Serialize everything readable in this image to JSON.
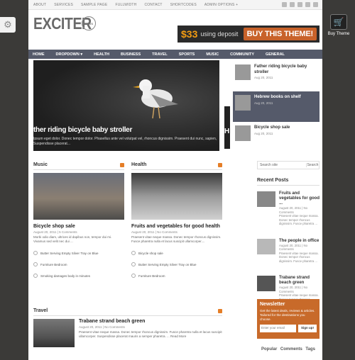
{
  "topnav": [
    "About",
    "Services",
    "Sample Page",
    "Fullwidth",
    "Contact",
    "Shortcodes",
    "Admin Options +"
  ],
  "logo": "EXCITER",
  "logo_badge": "NEWS",
  "ad": {
    "price": "$33",
    "using": "using deposit",
    "cta": "BUY THIS THEME!"
  },
  "buy_theme": "Buy Theme",
  "nav": [
    "Home",
    "Dropdown",
    "Health",
    "Business",
    "Travel",
    "Sports",
    "Music",
    "Community",
    "General"
  ],
  "slider": {
    "title": "ther riding bicycle baby stroller",
    "text": "Ipsum eget dolor. Donec tempor dolor. Phasellus ante vel volutpat vel, rhoncus dignissim. Praesent dui nunc, sapien, Suspendisse placerat..."
  },
  "slider_next_initial": "H",
  "thumbs": [
    {
      "title": "Father riding bicycle baby stroller",
      "date": "Aug 20, 2011"
    },
    {
      "title": "Hebrew books on shelf",
      "date": "Aug 20, 2011"
    },
    {
      "title": "Bicycle shop sale",
      "date": "Aug 20, 2011"
    }
  ],
  "music": {
    "heading": "Music",
    "title": "Bicycle shop sale",
    "meta": "August 20, 2011 | 5 Comments",
    "excerpt": "Morbi odio diam, ultrices id dapibus non, tempor dui mi. Vivamus sed velit nec dui ...",
    "links": [
      "Butter Serving Empty Silver Tray on Blue",
      "Furniture Bedroom",
      "Smoking damages body in minutes"
    ]
  },
  "health": {
    "heading": "Health",
    "title": "Fruits and vegetables for good health",
    "meta": "August 20, 2011 | No Comments",
    "excerpt": "Praesent vitae neque massa. Donec tempor rhoncus dignissim. Fusce pharetra nulla et lacus suscipit ullamcorper....",
    "links": [
      "Bicycle shop sale",
      "Butter Serving Empty Silver Tray on Blue",
      "Furniture Bedroom"
    ]
  },
  "travel": {
    "heading": "Travel",
    "title": "Trabane strand beach green",
    "meta": "August 20, 2011 | No Comments",
    "excerpt": "Praesent vitae neque massa. Donec tempor rhoncus dignissim. Fusce pharetra nulla et lacus suscipit ullamcorper. Suspendisse placerat mauris a semper pharetra. ... Read More"
  },
  "search": {
    "placeholder": "Search site",
    "button": "Search"
  },
  "recent_heading": "Recent Posts",
  "recent": [
    {
      "title": "Fruits and vegetables for good ...",
      "meta": "August 20, 2011 | No Comments",
      "excerpt": "Praesent vitae neque massa. Donec tempor rhoncus dignissim. Fusce pharetra ..."
    },
    {
      "title": "The people in office",
      "meta": "August 20, 2011 | No Comments",
      "excerpt": "Praesent vitae neque massa. Donec tempor rhoncus dignissim. Fusce pharetra ..."
    },
    {
      "title": "Trabane strand beach green",
      "meta": "August 20, 2011 | No Comments",
      "excerpt": "Praesent vitae neque massa. Donec tempor rhoncus dignissim. Fusce pharetra ..."
    }
  ],
  "newsletter": {
    "title": "Newsletter",
    "desc": "Get the latest deals, reviews & articles. Tailored for the destinations you choose.",
    "placeholder": "Enter your email",
    "button": "Sign up!"
  },
  "tabs": [
    "Popular",
    "Comments",
    "Tags"
  ]
}
